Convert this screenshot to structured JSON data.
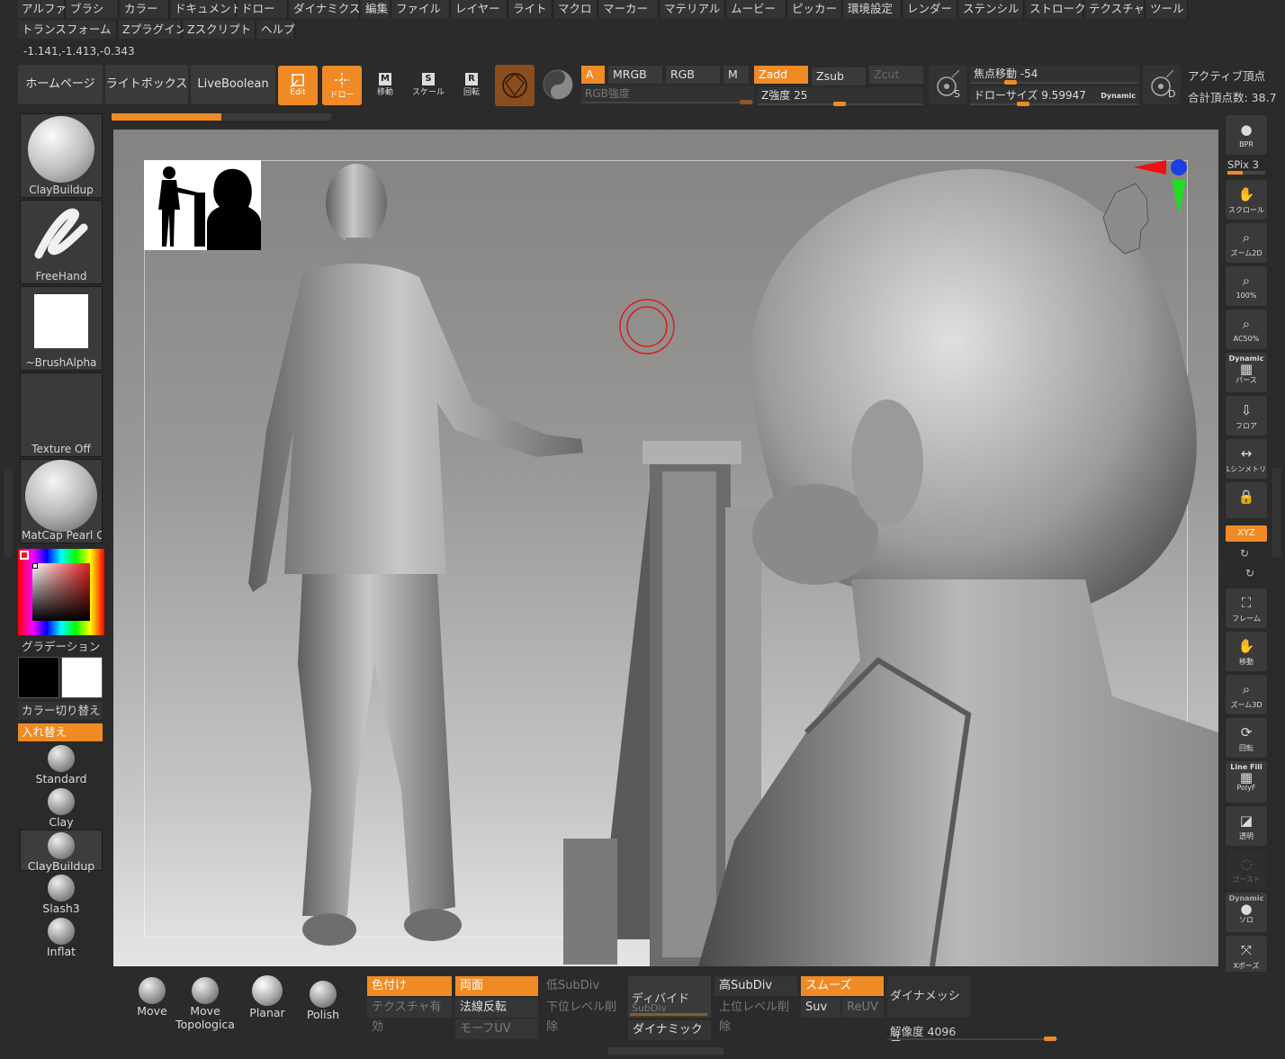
{
  "menu": {
    "row1": [
      "アルファ",
      "ブラシ",
      "カラー",
      "ドキュメント",
      "ドロー",
      "ダイナミクス",
      "編集",
      "ファイル",
      "レイヤー",
      "ライト",
      "マクロ",
      "マーカー",
      "マテリアル",
      "ムービー",
      "ピッカー",
      "環境設定",
      "レンダー",
      "ステンシル",
      "ストローク",
      "テクスチャ",
      "ツール"
    ],
    "row2": [
      "トランスフォーム",
      "Zプラグイン",
      "Zスクリプト",
      "ヘルプ"
    ]
  },
  "coords": "-1.141,-1.413,-0.343",
  "top": {
    "home": "ホームページ",
    "lightbox": "ライトボックス",
    "liveboolean": "LiveBoolean",
    "edit": "Edit",
    "draw": "ドロー",
    "move": "移動",
    "scale": "スケール",
    "rotate": "回転",
    "key_m": "M",
    "key_s": "S",
    "key_r": "R",
    "a": "A",
    "mrgb": "MRGB",
    "rgb": "RGB",
    "m": "M",
    "zadd": "Zadd",
    "zsub": "Zsub",
    "zcut": "Zcut",
    "rgb_intensity": "RGB強度",
    "z_intensity_label": "Z強度",
    "z_intensity_value": "25",
    "focal_label": "焦点移動",
    "focal_value": "-54",
    "drawsize_label": "ドローサイズ",
    "drawsize_value": "9.59947",
    "dynamic": "Dynamic",
    "s_label": "S",
    "d_label": "D",
    "active_points": "アクティブ頂点",
    "total_points": "合計頂点数: 38.7"
  },
  "left": {
    "brush": "ClayBuildup",
    "stroke": "FreeHand",
    "alpha": "~BrushAlpha",
    "texture": "Texture Off",
    "material": "MatCap Pearl Ca",
    "gradient": "グラデーション",
    "color_switch": "カラー切り替え",
    "swap": "入れ替え",
    "brushes": [
      "Standard",
      "Clay",
      "ClayBuildup",
      "Slash3",
      "Inflat"
    ]
  },
  "right": {
    "bpr": "BPR",
    "spix": "SPix 3",
    "scroll": "スクロール",
    "zoom2d": "ズーム2D",
    "hundred": "100%",
    "ac50": "AC50%",
    "dynamic_top": "Dynamic",
    "perspective": "パース",
    "floor": "フロア",
    "lsym": "Lシンメトリ",
    "xyz": "XYZ",
    "frame": "フレーム",
    "move": "移動",
    "zoom3d": "ズーム3D",
    "rotate": "回転",
    "linefill": "Line Fill",
    "polyf": "PolyF",
    "transp": "透明",
    "ghost": "ゴースト",
    "dynamic_solo": "Dynamic",
    "solo": "ソロ",
    "xpose": "Xポーズ"
  },
  "bottom": {
    "brushes": [
      "Move",
      "Move Topologica",
      "Planar",
      "Polish"
    ],
    "colorize": "色付け",
    "texture_on": "テクスチャ有効",
    "double": "両面",
    "flip": "法線反転",
    "morphuv": "モーフUV",
    "low_subdiv": "低SubDiv",
    "del_lower": "下位レベル削除",
    "divide": "ディバイド",
    "subdiv": "SubDiv",
    "dynamic": "ダイナミック",
    "high_subdiv": "高SubDiv",
    "del_higher": "上位レベル削除",
    "smooth": "スムーズ",
    "suv": "Suv",
    "reuv": "ReUV",
    "dynamesh": "ダイナメッシュ",
    "resolution_label": "解像度",
    "resolution_value": "4096"
  }
}
